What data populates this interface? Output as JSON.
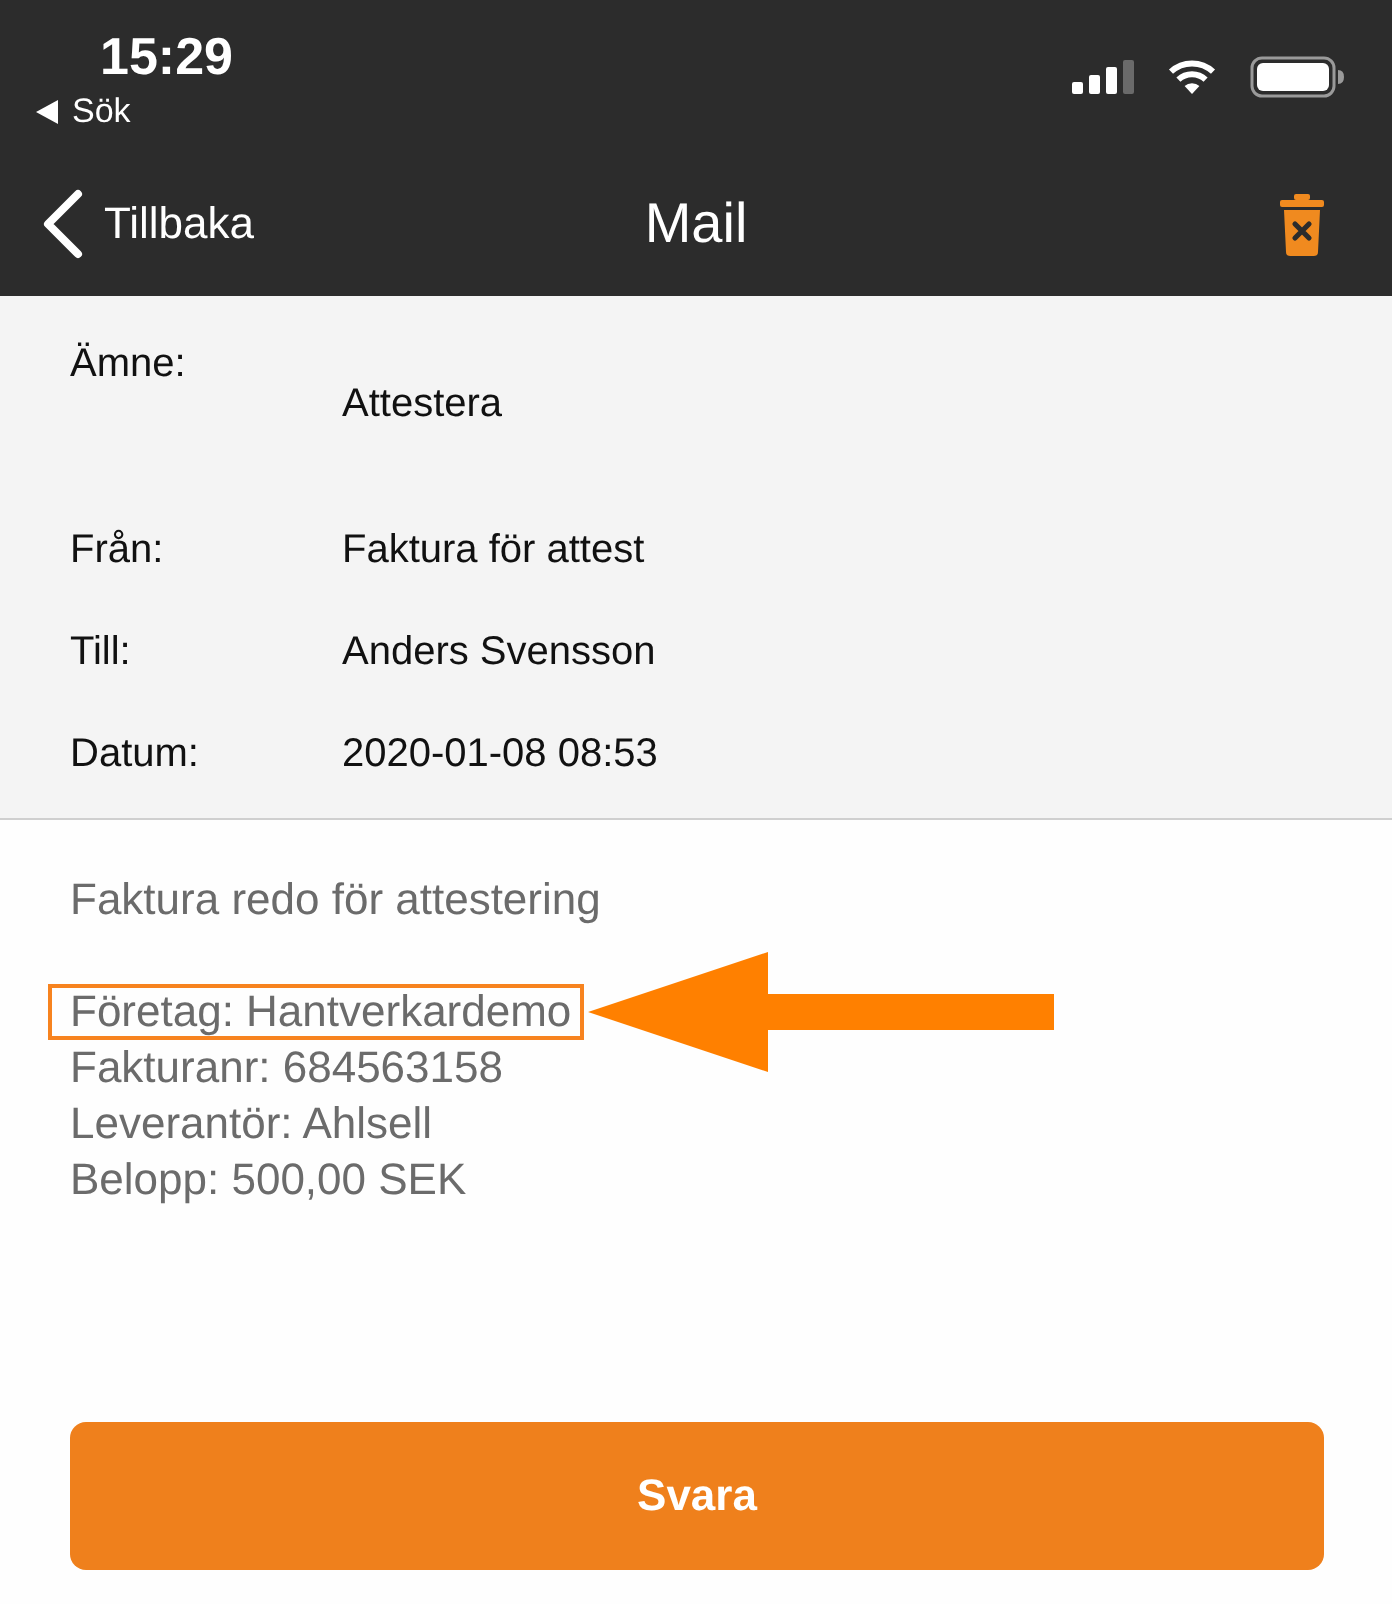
{
  "status_bar": {
    "time": "15:29",
    "back_app": "Sök"
  },
  "nav": {
    "back": "Tillbaka",
    "title": "Mail"
  },
  "header": {
    "fields": [
      {
        "kind": "stacked",
        "label": "Ämne:",
        "value": "Attestera"
      },
      {
        "kind": "inline",
        "label": "Från:",
        "value": "Faktura för attest"
      },
      {
        "kind": "inline",
        "label": "Till:",
        "value": "Anders Svensson"
      },
      {
        "kind": "inline",
        "label": "Datum:",
        "value": "2020-01-08 08:53"
      }
    ]
  },
  "body": {
    "intro": "Faktura redo för attestering",
    "lines": [
      {
        "text": "Företag: Hantverkardemo",
        "highlighted": true
      },
      {
        "text": "Fakturanr: 684563158",
        "highlighted": false
      },
      {
        "text": "Leverantör: Ahlsell",
        "highlighted": false
      },
      {
        "text": "Belopp: 500,00 SEK",
        "highlighted": false
      }
    ]
  },
  "reply_button": "Svara"
}
